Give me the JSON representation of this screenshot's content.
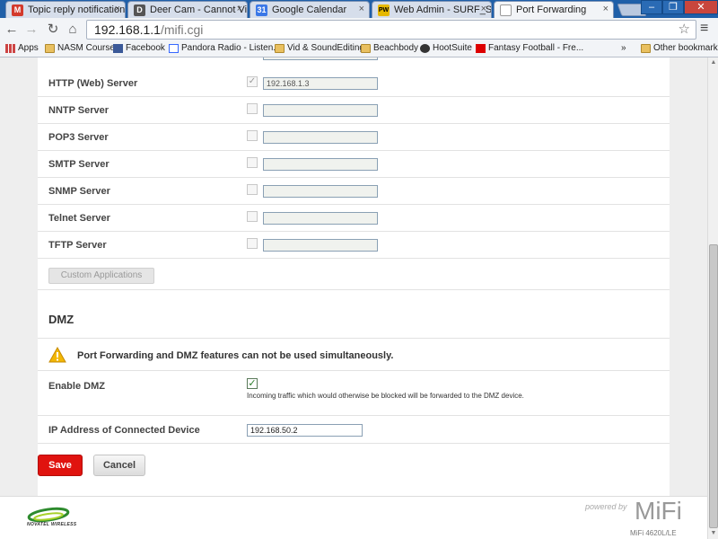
{
  "browser": {
    "tabs": [
      {
        "label": "Topic reply notification -",
        "icon_color": "#d33a2c",
        "icon_glyph": "M"
      },
      {
        "label": "Deer Cam - Cannot View",
        "icon_color": "#555555",
        "icon_glyph": "D"
      },
      {
        "label": "Google Calendar",
        "icon_color": "#3b78e7",
        "icon_glyph": "31"
      },
      {
        "label": "Web Admin - SURF_SOH",
        "icon_color": "#e6b800",
        "icon_glyph": "PW"
      },
      {
        "label": "Port Forwarding",
        "icon_color": "#ffffff",
        "icon_glyph": ""
      }
    ],
    "address_host": "192.168.1.1",
    "address_path": "/mifi.cgi",
    "bookmarks": [
      {
        "label": "Apps",
        "icon": "apps-icon"
      },
      {
        "label": "NASM Course",
        "icon": "folder-icon"
      },
      {
        "label": "Facebook",
        "icon": "facebook-icon"
      },
      {
        "label": "Pandora Radio - Listen...",
        "icon": "pandora-icon"
      },
      {
        "label": "Vid & SoundEditing",
        "icon": "folder-icon"
      },
      {
        "label": "Beachbody",
        "icon": "folder-icon"
      },
      {
        "label": "HootSuite",
        "icon": "hootsuite-icon"
      },
      {
        "label": "Fantasy Football - Fre...",
        "icon": "espn-icon"
      },
      {
        "label": "Other bookmarks",
        "icon": "folder-icon"
      }
    ],
    "overflow_label": "»"
  },
  "servers": [
    {
      "label": "HTTP (Web) Server",
      "checked": true,
      "ip": "192.168.1.3"
    },
    {
      "label": "NNTP Server",
      "checked": false,
      "ip": ""
    },
    {
      "label": "POP3 Server",
      "checked": false,
      "ip": ""
    },
    {
      "label": "SMTP Server",
      "checked": false,
      "ip": ""
    },
    {
      "label": "SNMP Server",
      "checked": false,
      "ip": ""
    },
    {
      "label": "Telnet Server",
      "checked": false,
      "ip": ""
    },
    {
      "label": "TFTP Server",
      "checked": false,
      "ip": ""
    }
  ],
  "custom_apps_label": "Custom Applications",
  "dmz": {
    "title": "DMZ",
    "warning": "Port Forwarding and DMZ features can not be used simultaneously.",
    "enable_label": "Enable DMZ",
    "enable_checked": true,
    "enable_hint": "Incoming traffic which would otherwise be blocked will be forwarded to the DMZ device.",
    "ip_label": "IP Address of Connected Device",
    "ip_value": "192.168.50.2"
  },
  "actions": {
    "save": "Save",
    "cancel": "Cancel"
  },
  "footer": {
    "vendor": "NOVATEL WIRELESS",
    "powered_by": "powered by",
    "brand": "MiFi",
    "model": "MiFi 4620L/LE"
  },
  "colors": {
    "save": "#e0130f",
    "chrome_frame": "#1f5fa8"
  }
}
